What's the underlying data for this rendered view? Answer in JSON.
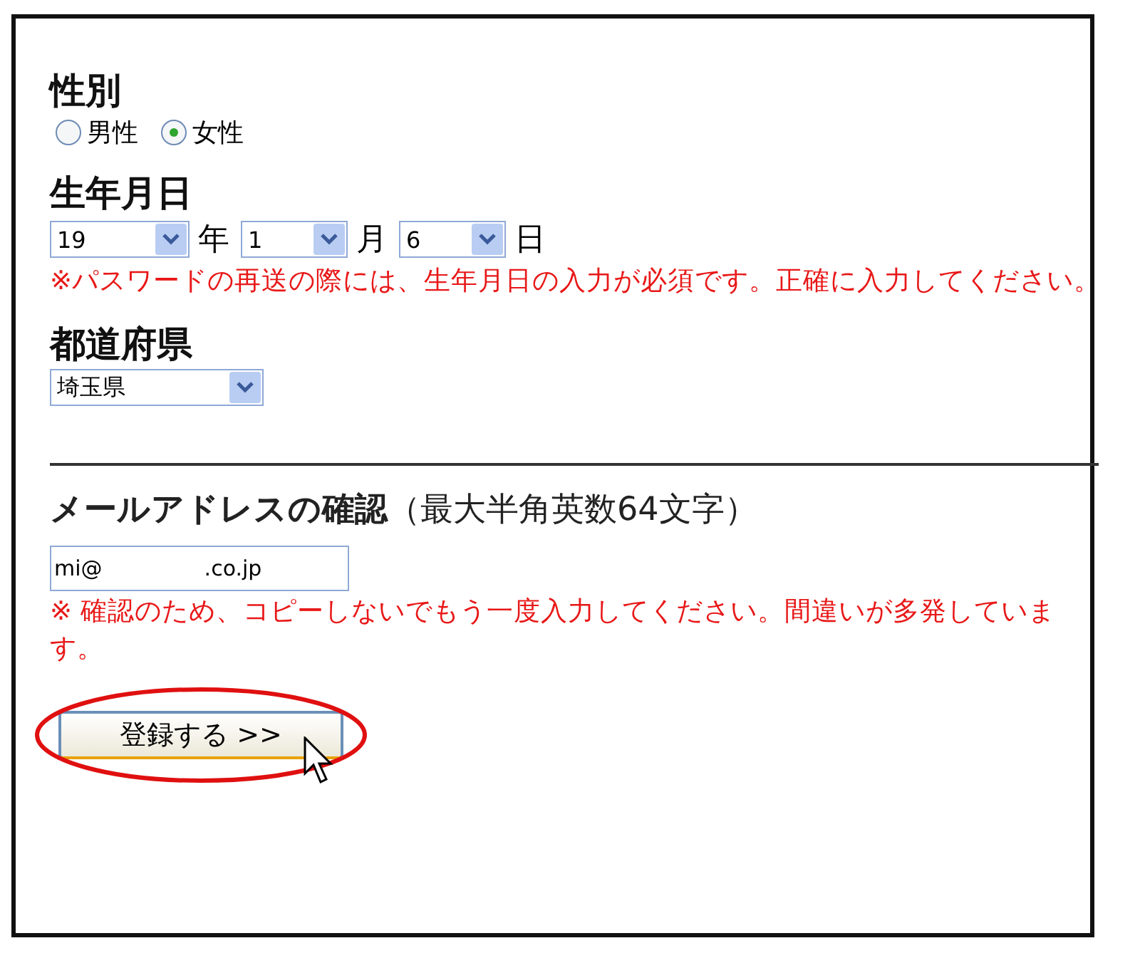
{
  "sections": [
    {
      "kind": "radio",
      "heading": "性別",
      "options": [
        {
          "label": "男性",
          "selected": false
        },
        {
          "label": "女性",
          "selected": true
        }
      ]
    },
    {
      "kind": "date",
      "heading": "生年月日",
      "selects": [
        {
          "value": "19",
          "unit": "年"
        },
        {
          "value": "1",
          "unit": "月"
        },
        {
          "value": "6",
          "unit": "日"
        }
      ],
      "note": "※パスワードの再送の際には、生年月日の入力が必須です。正確に入力してください。"
    },
    {
      "kind": "select",
      "heading": "都道府県",
      "value": "埼玉県"
    },
    {
      "kind": "email",
      "heading": "**メールアドレスの確認**（最大半角英数64文字）",
      "value": "mi@               .co.jp",
      "note": "※ 確認のため、コピーしないでもう一度入力してください。間違いが多発しています。"
    }
  ],
  "submit": {
    "label": "登録する >>",
    "highlighted": true
  }
}
